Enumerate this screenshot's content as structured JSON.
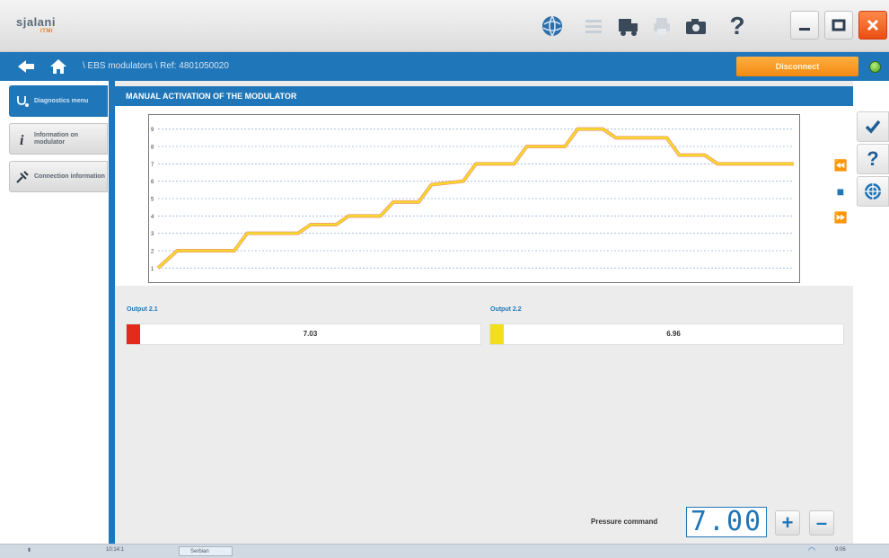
{
  "app": {
    "logo_text": "sjalani",
    "logo_sub": "ITMI"
  },
  "toolbar": {
    "icons": [
      "globe-icon",
      "list-icon",
      "truck-icon",
      "printer-icon",
      "camera-icon",
      "help-icon"
    ],
    "help_label": "?"
  },
  "window_controls": {
    "minimize": "–",
    "maximize": "□",
    "close": "✕"
  },
  "navbar": {
    "breadcrumb": "\\ EBS modulators \\ Ref: 4801050020",
    "disconnect_label": "Disconnect",
    "status_color": "#5bb82a"
  },
  "sidebar": {
    "items": [
      {
        "label": "Diagnostics menu",
        "icon": "stethoscope-icon",
        "active": true
      },
      {
        "label": "Information on modulator",
        "icon": "info-icon",
        "active": false
      },
      {
        "label": "Connection information",
        "icon": "connection-icon",
        "active": false
      }
    ]
  },
  "panel": {
    "title": "MANUAL ACTIVATION OF THE MODULATOR"
  },
  "chart_data": {
    "type": "line",
    "y_ticks": [
      "1",
      "2",
      "3",
      "4",
      "5",
      "6",
      "7",
      "8",
      "9"
    ],
    "ylim": [
      0.5,
      9.5
    ],
    "grid": true,
    "series": [
      {
        "color": "#e83c1c",
        "x": [
          0,
          0.03,
          0.12,
          0.14,
          0.22,
          0.24,
          0.28,
          0.3,
          0.35,
          0.37,
          0.41,
          0.43,
          0.48,
          0.5,
          0.56,
          0.58,
          0.64,
          0.66,
          0.7,
          0.72,
          0.8,
          0.82,
          0.86,
          0.88,
          1.0
        ],
        "values": [
          1,
          2,
          2,
          3,
          3,
          3.5,
          3.5,
          4,
          4,
          4.8,
          4.8,
          5.8,
          6,
          7,
          7,
          8,
          8,
          9,
          9,
          8.5,
          8.5,
          7.5,
          7.5,
          7,
          7
        ]
      },
      {
        "color": "#f5e01e",
        "x": [
          0,
          0.03,
          0.12,
          0.14,
          0.22,
          0.24,
          0.28,
          0.3,
          0.35,
          0.37,
          0.41,
          0.43,
          0.48,
          0.5,
          0.56,
          0.58,
          0.64,
          0.66,
          0.7,
          0.72,
          0.8,
          0.82,
          0.86,
          0.88,
          1.0
        ],
        "values": [
          1,
          2,
          2,
          3,
          3,
          3.5,
          3.5,
          4,
          4,
          4.8,
          4.8,
          5.8,
          6,
          7,
          7,
          8,
          8,
          9,
          9,
          8.5,
          8.5,
          7.5,
          7.5,
          7,
          7
        ]
      }
    ]
  },
  "chart_controls": {
    "rewind": "⏪",
    "stop": "■",
    "forward": "⏩"
  },
  "outputs": [
    {
      "label": "Output 2.1",
      "value": "7.03",
      "color": "#e32b1b"
    },
    {
      "label": "Output 2.2",
      "value": "6.96",
      "color": "#f2df1a"
    }
  ],
  "pressure": {
    "label": "Pressure command",
    "value": "7.00",
    "plus": "+",
    "minus": "–"
  },
  "rightbar": {
    "icons": [
      "check-icon",
      "help-icon",
      "target-icon"
    ]
  },
  "taskbar": {
    "time_text": "10:14:1",
    "task_label": "Serbian",
    "clock": "9:06"
  }
}
